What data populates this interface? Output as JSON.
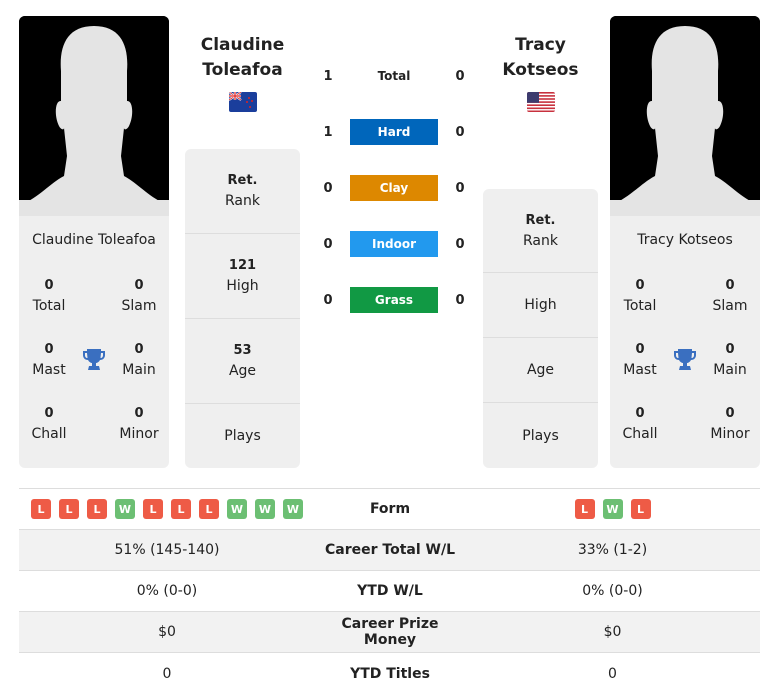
{
  "player1": {
    "name_line1": "Claudine",
    "name_line2": "Toleafoa",
    "full_name": "Claudine Toleafoa",
    "flag": "new-zealand",
    "titles": {
      "total": "0",
      "slam": "0",
      "mast": "0",
      "main": "0",
      "chall": "0",
      "minor": "0"
    },
    "rank": {
      "value": "Ret.",
      "label": "Rank"
    },
    "high": {
      "value": "121",
      "label": "High"
    },
    "age": {
      "value": "53",
      "label": "Age"
    },
    "plays": {
      "value": "",
      "label": "Plays"
    },
    "form": [
      "L",
      "L",
      "L",
      "W",
      "L",
      "L",
      "L",
      "W",
      "W",
      "W"
    ],
    "career_wl": "51% (145-140)",
    "ytd_wl": "0% (0-0)",
    "prize": "$0",
    "ytd_titles": "0"
  },
  "player2": {
    "name_line1": "Tracy",
    "name_line2": "Kotseos",
    "full_name": "Tracy Kotseos",
    "flag": "united-states",
    "titles": {
      "total": "0",
      "slam": "0",
      "mast": "0",
      "main": "0",
      "chall": "0",
      "minor": "0"
    },
    "rank": {
      "value": "Ret.",
      "label": "Rank"
    },
    "high": {
      "value": "",
      "label": "High"
    },
    "age": {
      "value": "",
      "label": "Age"
    },
    "plays": {
      "value": "",
      "label": "Plays"
    },
    "form": [
      "L",
      "W",
      "L"
    ],
    "career_wl": "33% (1-2)",
    "ytd_wl": "0% (0-0)",
    "prize": "$0",
    "ytd_titles": "0"
  },
  "stat_labels": {
    "total": "Total",
    "slam": "Slam",
    "mast": "Mast",
    "main": "Main",
    "chall": "Chall",
    "minor": "Minor"
  },
  "h2h": [
    {
      "label": "Total",
      "p1": "1",
      "p2": "0",
      "color": null
    },
    {
      "label": "Hard",
      "p1": "1",
      "p2": "0",
      "color": "#0066bb"
    },
    {
      "label": "Clay",
      "p1": "0",
      "p2": "0",
      "color": "#dd8800"
    },
    {
      "label": "Indoor",
      "p1": "0",
      "p2": "0",
      "color": "#2299ee"
    },
    {
      "label": "Grass",
      "p1": "0",
      "p2": "0",
      "color": "#119944"
    }
  ],
  "table_labels": {
    "form": "Form",
    "career_wl": "Career Total W/L",
    "ytd_wl": "YTD W/L",
    "prize": "Career Prize Money",
    "ytd_titles": "YTD Titles"
  },
  "colors": {
    "trophy": "#3a6fc0",
    "loss": "#ee5b46",
    "win": "#6cbf73"
  }
}
